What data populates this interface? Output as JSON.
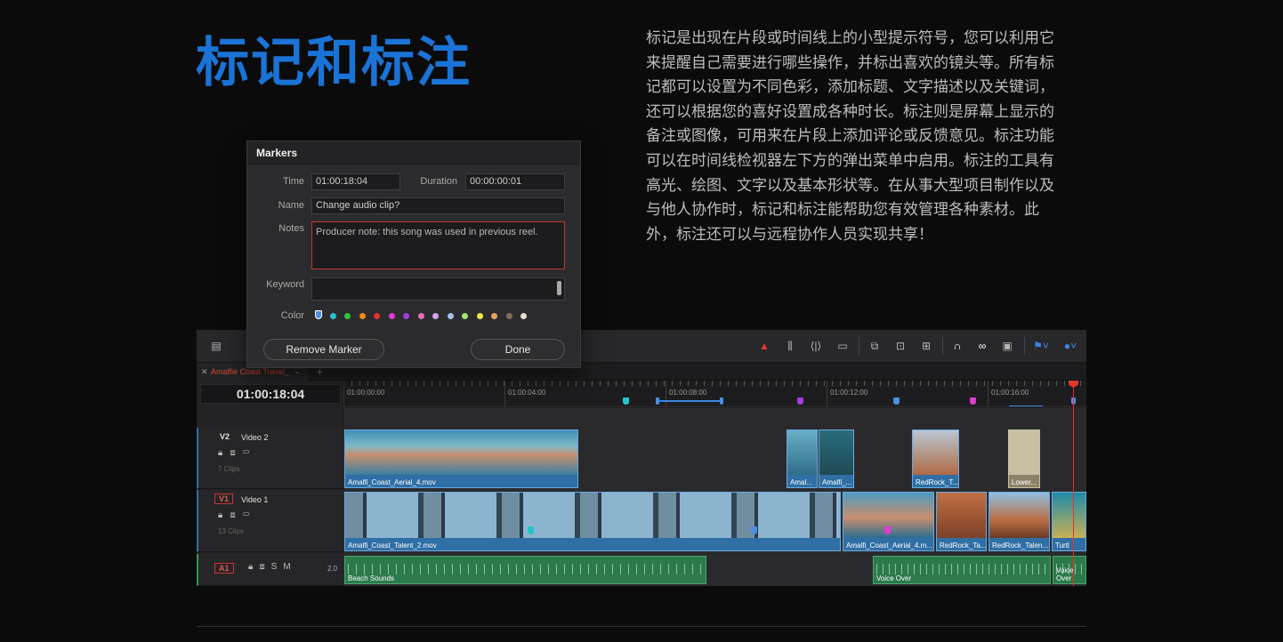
{
  "heading": "标记和标注",
  "description": "标记是出现在片段或时间线上的小型提示符号，您可以利用它来提醒自己需要进行哪些操作，并标出喜欢的镜头等。所有标记都可以设置为不同色彩，添加标题、文字描述以及关键词，还可以根据您的喜好设置成各种时长。标注则是屏幕上显示的备注或图像，可用来在片段上添加评论或反馈意见。标注功能可以在时间线检视器左下方的弹出菜单中启用。标注的工具有高光、绘图、文字以及基本形状等。在从事大型项目制作以及与他人协作时，标记和标注能帮助您有效管理各种素材。此外，标注还可以与远程协作人员实现共享！",
  "dialog": {
    "title": "Markers",
    "time_label": "Time",
    "time_value": "01:00:18:04",
    "duration_label": "Duration",
    "duration_value": "00:00:00:01",
    "name_label": "Name",
    "name_value": "Change audio clip?",
    "notes_label": "Notes",
    "notes_value": "Producer note: this song was used in previous reel.",
    "keyword_label": "Keyword",
    "keyword_value": "",
    "color_label": "Color",
    "colors": [
      "#4a8fe0",
      "#27c3c9",
      "#2fc43c",
      "#f08a1a",
      "#e33030",
      "#e03ad0",
      "#a23de0",
      "#e86fb6",
      "#c9a6e8",
      "#a8c4e6",
      "#a3e27a",
      "#f0e64a",
      "#e8a25e",
      "#8a6b58",
      "#eae0cc"
    ],
    "remove_button": "Remove Marker",
    "done_button": "Done"
  },
  "timeline": {
    "tab_name": "Amalfie Coast Travel_",
    "timecode": "01:00:18:04",
    "ruler_labels": [
      "01:00:00:00",
      "01:00:04:00",
      "01:00:08:00",
      "01:00:12:00",
      "01:00:16:00"
    ],
    "ruler_markers": [
      {
        "color": "#27c3c9"
      },
      {
        "color": "#4a8fe0"
      },
      {
        "color": "#a23de0"
      },
      {
        "color": "#4a8fe0"
      },
      {
        "color": "#e03ad0"
      }
    ],
    "tracks": [
      {
        "id": "V2",
        "name": "Video 2",
        "clips": "7 Clips"
      },
      {
        "id": "V1",
        "name": "Video 1",
        "clips": "13 Clips"
      },
      {
        "id": "A1",
        "name": "",
        "level": "2.0"
      }
    ],
    "v2_clips": [
      "Amalfi_Coast_Aerial_4.mov",
      "Amal...",
      "Amalfi_...",
      "RedRock_T...",
      "Lower..."
    ],
    "v1_clips": [
      "Amalfi_Coast_Talent_2.mov",
      "Amalfi_Coast_Aerial_4.m...",
      "RedRock_Ta...",
      "RedRock_Talen...",
      "Turtl"
    ],
    "a1_clips": [
      "Beach Sounds",
      "Voice Over",
      "Voice Over"
    ],
    "accent": "#e0362c"
  }
}
